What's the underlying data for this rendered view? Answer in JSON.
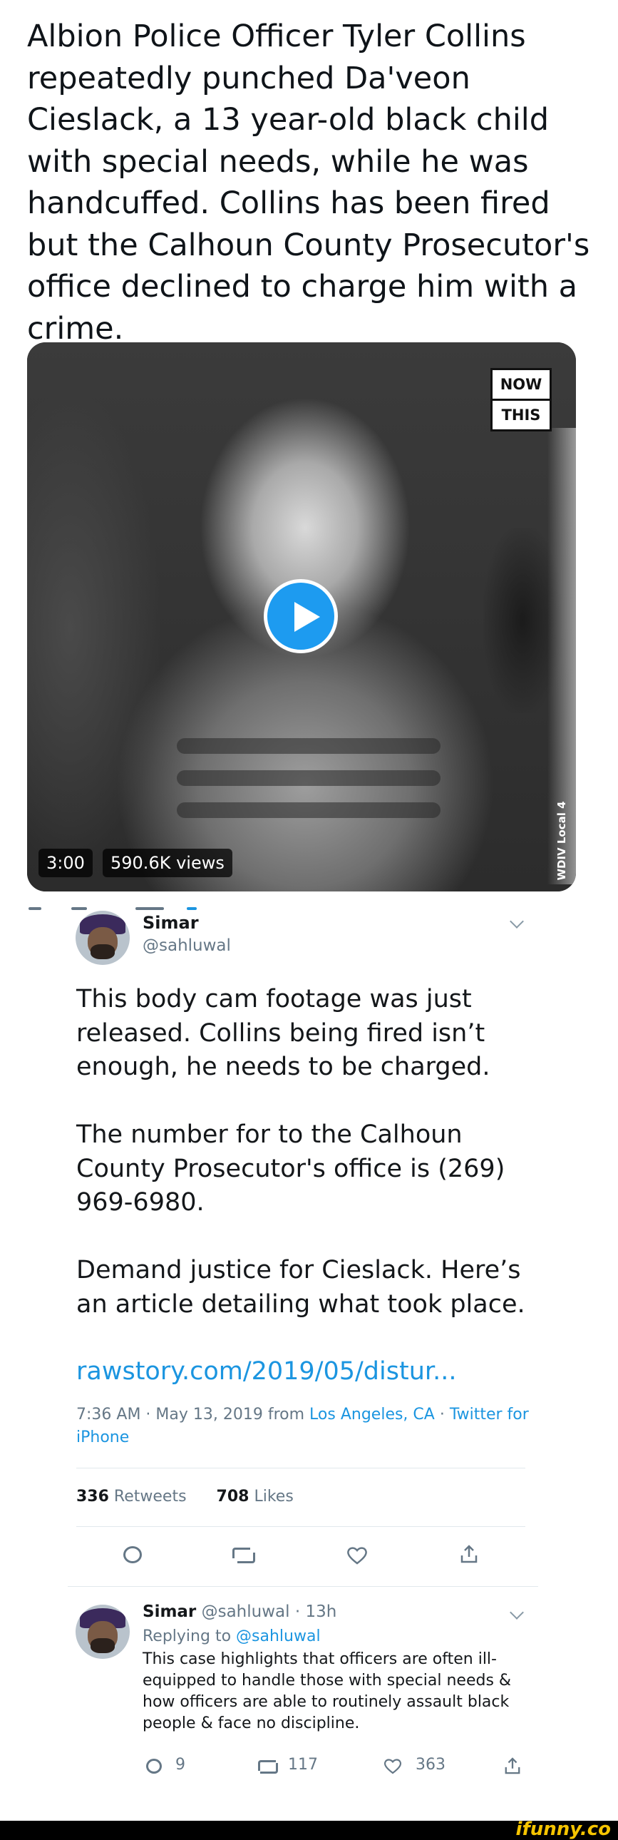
{
  "post": {
    "headline": "Albion Police Officer Tyler Collins repeatedly punched Da'veon Cieslack, a 13 year-old black child with special needs, while he was handcuffed. Collins has been fired but the Calhoun County Prosecutor's office declined to charge him with a crime."
  },
  "video": {
    "badge_line1": "NOW",
    "badge_line2": "THIS",
    "watermark": "WDIV Local 4",
    "duration": "3:00",
    "views": "590.6K views"
  },
  "tweet": {
    "author_name": "Simar",
    "author_handle": "@sahluwal",
    "body": [
      "This body cam footage was just released. Collins being fired isn’t enough, he needs to be charged.",
      "The number for to the Calhoun County Prosecutor's office is (269) 969-6980.",
      "Demand justice for Cieslack. Here’s an article detailing what took place."
    ],
    "link": "rawstory.com/2019/05/distur...",
    "timestamp": "7:36 AM · May 13, 2019 from ",
    "location": "Los Angeles, CA",
    "separator": " · ",
    "client": "Twitter for iPhone",
    "retweets_count": "336",
    "retweets_label": " Retweets",
    "likes_count": "708",
    "likes_label": " Likes"
  },
  "reply": {
    "author_name": "Simar",
    "author_handle": "@sahluwal",
    "time": " · 13h",
    "replying_label": "Replying to ",
    "replying_to": "@sahluwal",
    "body": "This case highlights that officers are often ill-equipped to handle those with special needs & how officers are able to routinely assault black people & face no discipline.",
    "reply_count": "9",
    "retweet_count": "117",
    "like_count": "363"
  },
  "footer": {
    "brand": "ifunny.co"
  },
  "colors": {
    "link_blue": "#1b95e0",
    "secondary_gray": "#657786",
    "play_blue": "#1d9bf0"
  }
}
